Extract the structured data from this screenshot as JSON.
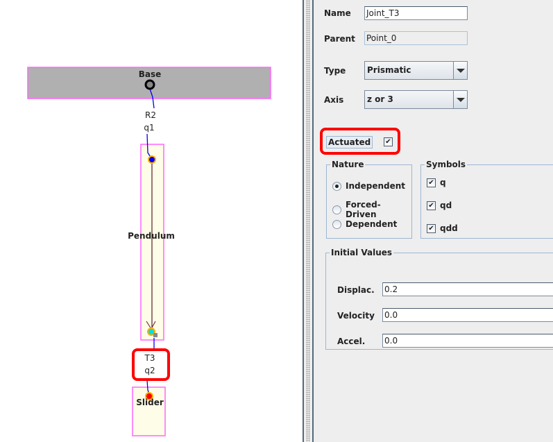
{
  "canvas": {
    "bodies": [
      {
        "label": "Base"
      },
      {
        "label": "Pendulum"
      },
      {
        "label": "Slider"
      }
    ],
    "joints": [
      {
        "name": "R2",
        "coord": "q1"
      },
      {
        "name": "T3",
        "coord": "q2"
      }
    ]
  },
  "form": {
    "name_label": "Name",
    "name_value": "Joint_T3",
    "parent_label": "Parent",
    "parent_value": "Point_0",
    "type_label": "Type",
    "type_value": "Prismatic",
    "axis_label": "Axis",
    "axis_value": "z or 3",
    "actuated_label": "Actuated",
    "actuated_checked": true
  },
  "nature": {
    "title": "Nature",
    "options": [
      {
        "label": "Independent",
        "selected": true
      },
      {
        "label": "Forced-Driven",
        "selected": false
      },
      {
        "label": "Dependent",
        "selected": false
      }
    ]
  },
  "symbols": {
    "title": "Symbols",
    "items": [
      {
        "label": "q",
        "checked": true
      },
      {
        "label": "qd",
        "checked": true
      },
      {
        "label": "qdd",
        "checked": true
      }
    ]
  },
  "initial": {
    "title": "Initial Values",
    "fields": [
      {
        "label": "Displac.",
        "value": "0.2"
      },
      {
        "label": "Velocity",
        "value": "0.0"
      },
      {
        "label": "Accel.",
        "value": "0.0"
      }
    ]
  },
  "colors": {
    "highlight": "#ff0000",
    "body_border": "#ff66ff",
    "base_fill": "#b0b0b0"
  },
  "check_glyph": "✔"
}
